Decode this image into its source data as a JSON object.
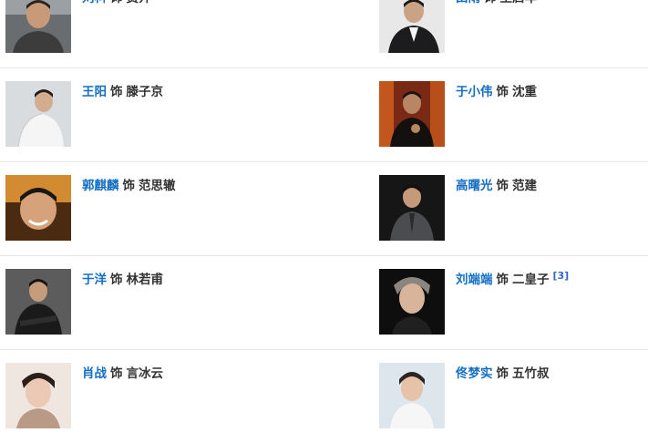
{
  "cast": {
    "rows": [
      [
        {
          "actor": "刘科",
          "as": "饰",
          "role": "费介",
          "ref": ""
        },
        {
          "actor": "田雨",
          "as": "饰",
          "role": "王启年",
          "ref": ""
        }
      ],
      [
        {
          "actor": "王阳",
          "as": "饰",
          "role": "滕子京",
          "ref": ""
        },
        {
          "actor": "于小伟",
          "as": "饰",
          "role": "沈重",
          "ref": ""
        }
      ],
      [
        {
          "actor": "郭麒麟",
          "as": "饰",
          "role": "范思辙",
          "ref": ""
        },
        {
          "actor": "高曙光",
          "as": "饰",
          "role": "范建",
          "ref": ""
        }
      ],
      [
        {
          "actor": "于洋",
          "as": "饰",
          "role": "林若甫",
          "ref": ""
        },
        {
          "actor": "刘端端",
          "as": "饰",
          "role": "二皇子",
          "ref": "[3]"
        }
      ],
      [
        {
          "actor": "肖战",
          "as": "饰",
          "role": "言冰云",
          "ref": ""
        },
        {
          "actor": "佟梦实",
          "as": "饰",
          "role": "五竹叔",
          "ref": ""
        }
      ]
    ]
  },
  "colors": {
    "link": "#136ec2",
    "text": "#333333",
    "divider": "#e6e6e6"
  }
}
